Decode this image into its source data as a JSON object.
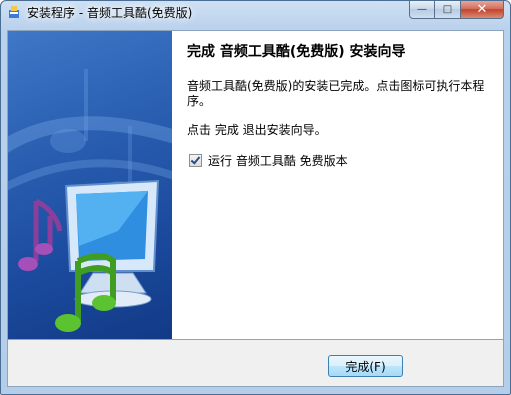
{
  "window": {
    "title": "安装程序 - 音频工具酷(免费版)",
    "minimize_glyph": "—",
    "maximize_glyph": "□",
    "close_glyph": "✕"
  },
  "wizard": {
    "heading": "完成 音频工具酷(免费版) 安装向导",
    "message": "音频工具酷(免费版)的安装已完成。点击图标可执行本程序。",
    "exit_hint": "点击 完成 退出安装向导。",
    "run_checkbox": {
      "label": "运行 音频工具酷 免费版本",
      "checked": true
    }
  },
  "buttons": {
    "finish_label": "完成(F)"
  },
  "icons": {
    "app": "installer-icon",
    "banner": "music-computer-illustration"
  }
}
